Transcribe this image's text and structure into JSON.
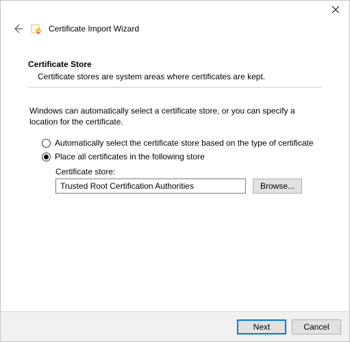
{
  "window": {
    "title": "Certificate Import Wizard"
  },
  "section": {
    "title": "Certificate Store",
    "description": "Certificate stores are system areas where certificates are kept."
  },
  "intro": "Windows can automatically select a certificate store, or you can specify a location for the certificate.",
  "radios": {
    "auto": {
      "label": "Automatically select the certificate store based on the type of certificate",
      "checked": false
    },
    "manual": {
      "label": "Place all certificates in the following store",
      "checked": true
    }
  },
  "store": {
    "label": "Certificate store:",
    "value": "Trusted Root Certification Authorities",
    "browse_label": "Browse..."
  },
  "footer": {
    "next": "Next",
    "cancel": "Cancel"
  }
}
